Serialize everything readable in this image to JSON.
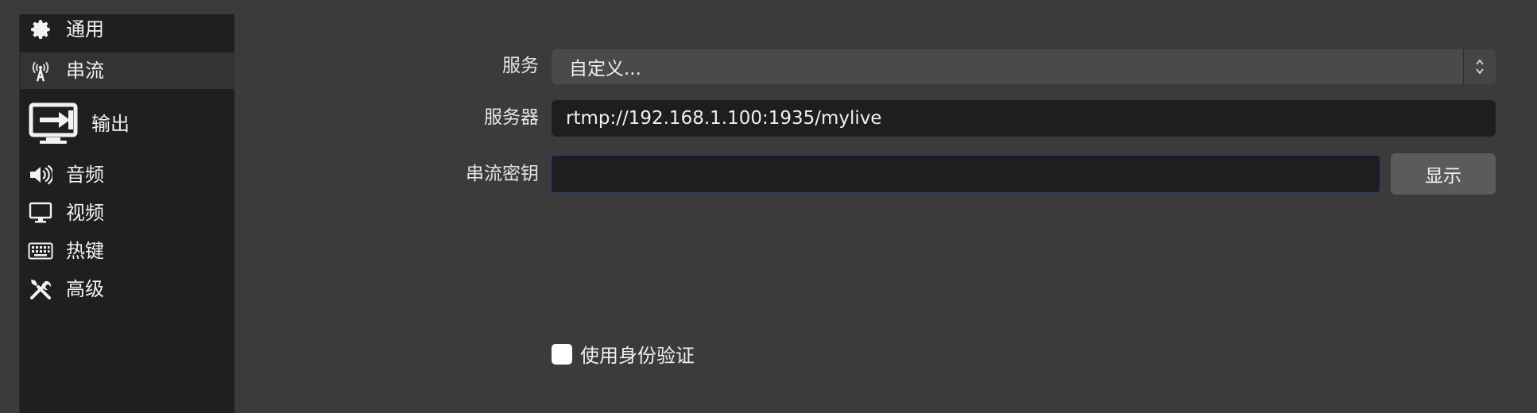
{
  "sidebar": {
    "items": [
      {
        "label": "通用",
        "icon": "gear-icon"
      },
      {
        "label": "串流",
        "icon": "antenna-icon",
        "selected": true
      },
      {
        "label": "输出",
        "icon": "output-icon"
      },
      {
        "label": "音频",
        "icon": "speaker-icon"
      },
      {
        "label": "视频",
        "icon": "monitor-icon"
      },
      {
        "label": "热键",
        "icon": "keyboard-icon"
      },
      {
        "label": "高级",
        "icon": "tools-icon"
      }
    ]
  },
  "form": {
    "service_label": "服务",
    "service_value": "自定义...",
    "server_label": "服务器",
    "server_value": "rtmp://192.168.1.100:1935/mylive",
    "key_label": "串流密钥",
    "key_value": "",
    "show_button": "显示",
    "auth_label": "使用身份验证",
    "auth_checked": false
  },
  "colors": {
    "background": "#3b3b3b",
    "sidebar": "#1f1f1f",
    "selected": "#333333",
    "field": "#1e1e1e",
    "focus_border": "#2b3c63"
  }
}
